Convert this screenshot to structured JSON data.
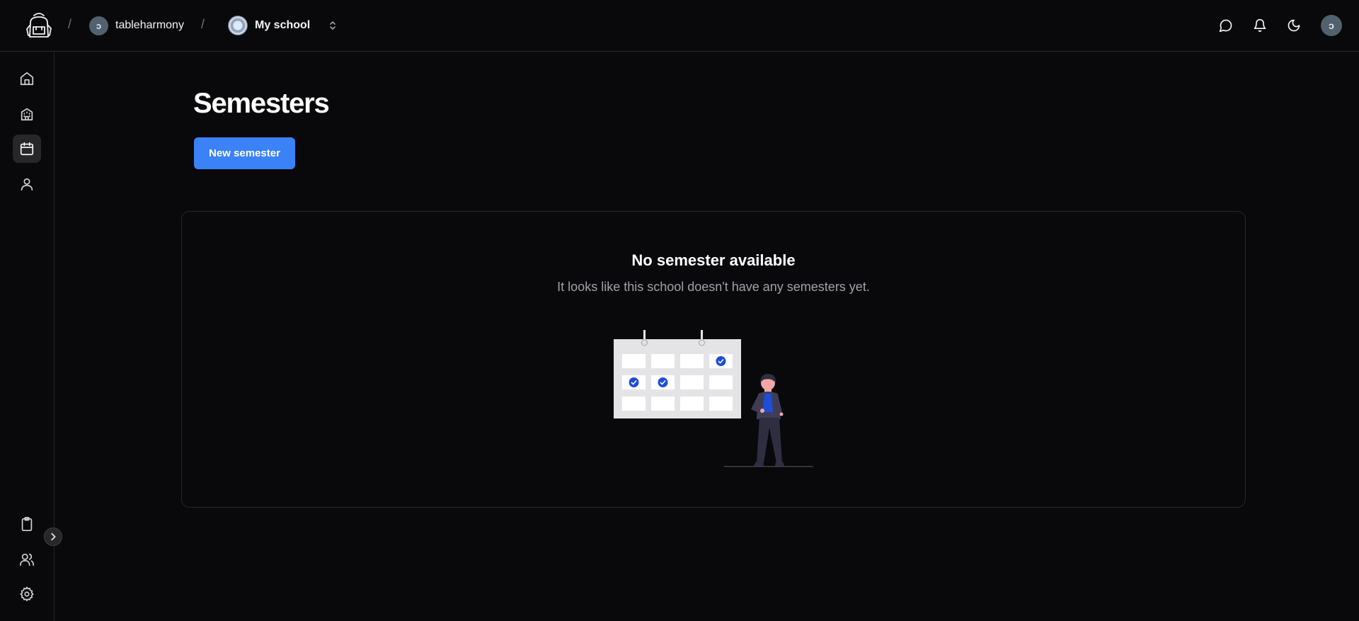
{
  "header": {
    "logo_icon": "backpack-logo-icon",
    "workspace": {
      "name": "tableharmony",
      "avatar_initial": "ↄ"
    },
    "school": {
      "name": "My school"
    },
    "separator": "/",
    "icons": [
      "chat-icon",
      "bell-icon",
      "moon-icon"
    ],
    "user_avatar_initial": "ↄ"
  },
  "sidebar": {
    "top_items": [
      {
        "name": "home",
        "icon": "home-icon",
        "active": false
      },
      {
        "name": "school",
        "icon": "building-icon",
        "active": false
      },
      {
        "name": "semesters",
        "icon": "calendar-icon",
        "active": true
      },
      {
        "name": "profile",
        "icon": "user-icon",
        "active": false
      }
    ],
    "bottom_items": [
      {
        "name": "clipboard",
        "icon": "clipboard-icon"
      },
      {
        "name": "users",
        "icon": "users-icon"
      },
      {
        "name": "settings",
        "icon": "gear-icon"
      }
    ],
    "collapse_icon": "chevron-right-icon"
  },
  "main": {
    "title": "Semesters",
    "new_button_label": "New semester",
    "empty_state": {
      "title": "No semester available",
      "description": "It looks like this school doesn't have any semesters yet.",
      "illustration": "calendar-with-person-illustration"
    }
  },
  "colors": {
    "background": "#09090b",
    "border": "#27272a",
    "accent": "#3b82f6",
    "muted_text": "#a1a1aa"
  }
}
